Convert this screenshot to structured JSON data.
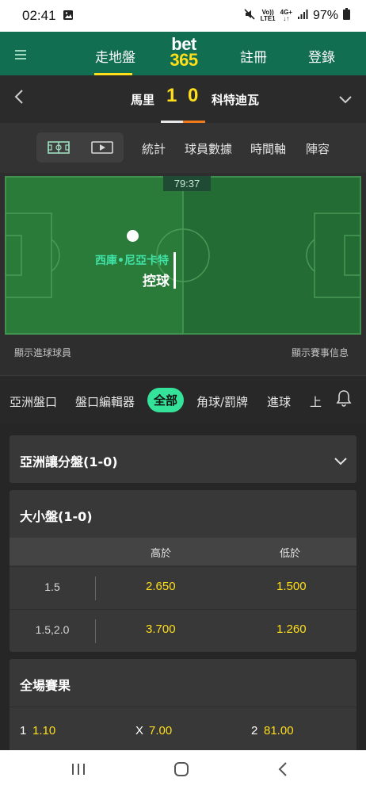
{
  "status_bar": {
    "time": "02:41",
    "net_top": "Vo))",
    "net_bottom": "LTE1",
    "signal_label": "4G+",
    "battery": "97%"
  },
  "top_nav": {
    "items": [
      "走地盤",
      "註冊",
      "登錄"
    ],
    "logo_top": "bet",
    "logo_bottom": "365",
    "accent": "#ffdf1b",
    "bg": "#126e51"
  },
  "match": {
    "home_team": "馬里",
    "home_score": "1",
    "away_score": "0",
    "away_team": "科特迪瓦"
  },
  "sub_tabs": [
    "統計",
    "球員數據",
    "時間軸",
    "陣容"
  ],
  "pitch": {
    "clock": "79:37",
    "possession_team": "西庫•尼亞卡特",
    "possession_label": "控球",
    "link_left": "顯示進球球員",
    "link_right": "顯示賽事信息"
  },
  "market_tabs": [
    "亞洲盤口",
    "盤口編輯器",
    "全部",
    "角球/罰牌",
    "進球",
    "上"
  ],
  "market_tabs_active": "全部",
  "markets": {
    "asian_handicap": {
      "title": "亞洲讓分盤(1-0)"
    },
    "over_under": {
      "title": "大小盤(1-0)",
      "col_over": "高於",
      "col_under": "低於",
      "rows": [
        {
          "line": "1.5",
          "over": "2.650",
          "under": "1.500"
        },
        {
          "line": "1.5,2.0",
          "over": "3.700",
          "under": "1.260"
        }
      ]
    },
    "full_time": {
      "title": "全場賽果",
      "home_label": "1",
      "home_odds": "1.10",
      "draw_label": "X",
      "draw_odds": "7.00",
      "away_label": "2",
      "away_odds": "81.00"
    }
  },
  "colors": {
    "odds": "#ffdf1b",
    "possession": "#3fe3a5",
    "active_tab": "#35e29a"
  }
}
